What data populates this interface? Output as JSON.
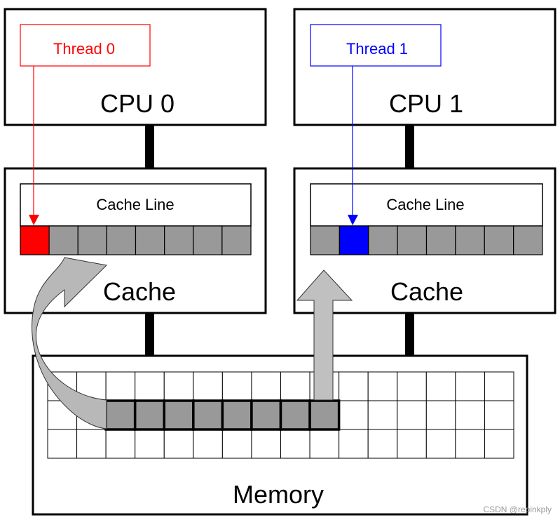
{
  "cpus": [
    {
      "label": "CPU 0",
      "thread_label": "Thread 0",
      "thread_color": "#ff0000",
      "active_cell": 0
    },
    {
      "label": "CPU 1",
      "thread_label": "Thread 1",
      "thread_color": "#0000ff",
      "active_cell": 1
    }
  ],
  "cache": {
    "label": "Cache",
    "line_label": "Cache Line",
    "cells": 8,
    "cell_color": "#999999"
  },
  "memory": {
    "label": "Memory",
    "columns": 16,
    "rows": 3,
    "highlight_row": 1,
    "highlight_start_col": 2,
    "highlight_length": 8
  },
  "arrow_color": "#c0c0c0",
  "watermark": "CSDN @repinkply"
}
